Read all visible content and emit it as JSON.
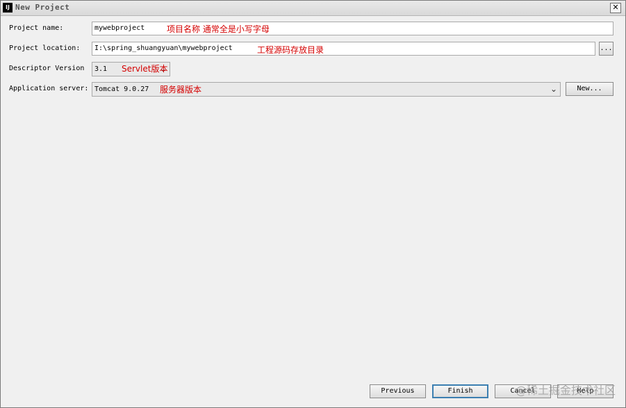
{
  "window": {
    "title": "New Project",
    "app_icon_text": "IJ",
    "close_symbol": "✕"
  },
  "form": {
    "project_name": {
      "label": "Project name:",
      "value": "mywebproject"
    },
    "project_location": {
      "label": "Project location:",
      "value": "I:\\spring_shuangyuan\\mywebproject",
      "browse_label": "..."
    },
    "descriptor_version": {
      "label": "Descriptor Version",
      "value": "3.1"
    },
    "application_server": {
      "label": "Application server:",
      "value": "Tomcat 9.0.27",
      "new_label": "New..."
    }
  },
  "annotations": {
    "project_name": "项目名称  通常全是小写字母",
    "project_location": "工程源码存放目录",
    "descriptor_version": "Servlet版本",
    "application_server": "服务器版本"
  },
  "buttons": {
    "previous": "Previous",
    "finish": "Finish",
    "cancel": "Cancel",
    "help": "Help"
  },
  "watermark": "@稀土掘金技术社区",
  "icons": {
    "dropdown_arrow": "chevron-down-icon",
    "dropdown_symbol": "⌄"
  },
  "colors": {
    "annotation": "#d40000",
    "default_button_border": "#3c7fb1"
  }
}
